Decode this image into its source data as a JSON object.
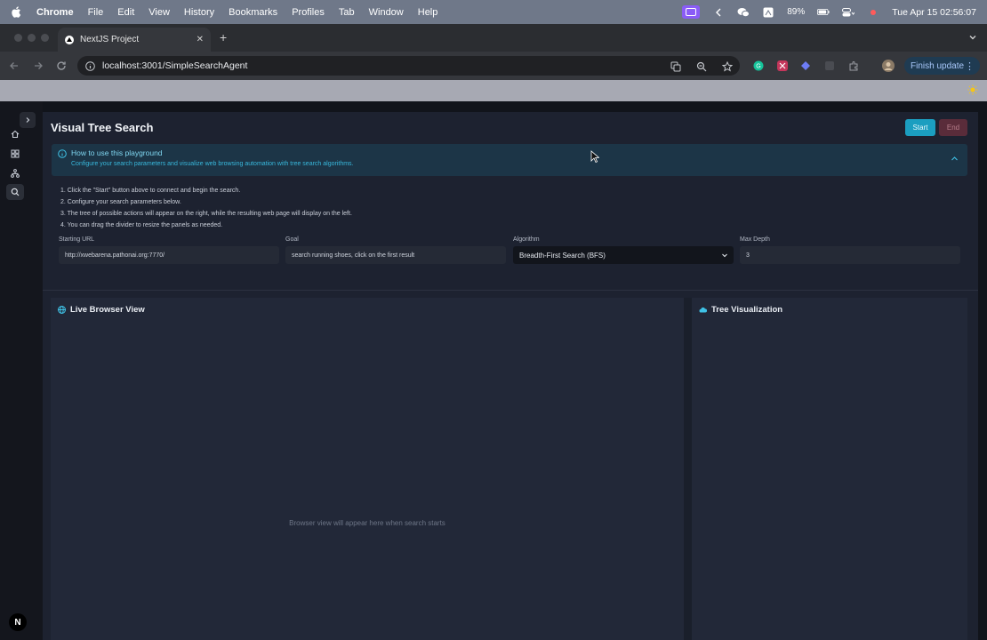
{
  "menubar": {
    "items": [
      "Chrome",
      "File",
      "Edit",
      "View",
      "History",
      "Bookmarks",
      "Profiles",
      "Tab",
      "Window",
      "Help"
    ],
    "battery": "89%",
    "datetime": "Tue Apr 15  02:56:07"
  },
  "browser": {
    "tab_title": "NextJS Project",
    "url": "localhost:3001/SimpleSearchAgent",
    "finish_update": "Finish update"
  },
  "app": {
    "page_title": "Visual Tree Search",
    "start_label": "Start",
    "end_label": "End",
    "help": {
      "title": "How to use this playground",
      "subtitle": "Configure your search parameters and visualize web browsing automation with tree search algorithms."
    },
    "steps": [
      "1. Click the \"Start\" button above to connect and begin the search.",
      "2. Configure your search parameters below.",
      "3. The tree of possible actions will appear on the right, while the resulting web page will display on the left.",
      "4. You can drag the divider to resize the panels as needed."
    ],
    "form": {
      "starting_url_label": "Starting URL",
      "starting_url_value": "http://xwebarena.pathonai.org:7770/",
      "goal_label": "Goal",
      "goal_value": "search running shoes, click on the first result",
      "algorithm_label": "Algorithm",
      "algorithm_value": "Breadth-First Search (BFS)",
      "max_depth_label": "Max Depth",
      "max_depth_value": "3"
    },
    "browser_panel": {
      "title": "Live Browser View",
      "placeholder": "Browser view will appear here when search starts"
    },
    "tree_panel": {
      "title": "Tree Visualization"
    }
  },
  "colors": {
    "accent": "#1b9ec0",
    "end_button": "#5a2c3a",
    "help_bg": "#1c3547",
    "panel_bg": "#222838"
  }
}
